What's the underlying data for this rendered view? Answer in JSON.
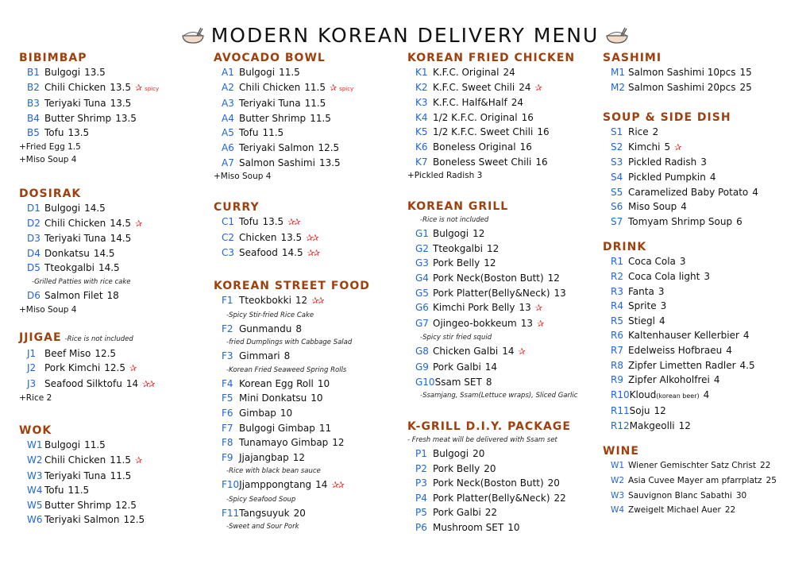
{
  "title": "MODERN KOREAN DELIVERY MENU",
  "colors": {
    "section": "#a0400c",
    "code": "#1f66d6",
    "spicy": "#e5231e"
  },
  "columns": [
    {
      "sections": [
        {
          "title": "BIBIMBAP",
          "note": "",
          "items": [
            {
              "code": "B1",
              "name": "Bulgogi",
              "price": "13.5",
              "spicy": 0
            },
            {
              "code": "B2",
              "name": "Chili Chicken",
              "price": "13.5",
              "spicy": 1,
              "spicy_label": "spicy"
            },
            {
              "code": "B3",
              "name": "Teriyaki Tuna",
              "price": "13.5",
              "spicy": 0
            },
            {
              "code": "B4",
              "name": "Butter Shrimp",
              "price": "13.5",
              "spicy": 0
            },
            {
              "code": "B5",
              "name": "Tofu",
              "price": "13.5",
              "spicy": 0
            }
          ],
          "addons": [
            "+Fried Egg 1.5",
            "+Miso Soup 4"
          ]
        },
        {
          "title": "DOSIRAK",
          "note": "",
          "items": [
            {
              "code": "D1",
              "name": "Bulgogi",
              "price": "14.5",
              "spicy": 0
            },
            {
              "code": "D2",
              "name": "Chili Chicken",
              "price": "14.5",
              "spicy": 1
            },
            {
              "code": "D3",
              "name": "Teriyaki Tuna",
              "price": "14.5",
              "spicy": 0
            },
            {
              "code": "D4",
              "name": "Donkatsu",
              "price": "14.5",
              "spicy": 0
            },
            {
              "code": "D5",
              "name": "Tteokgalbi",
              "price": "14.5",
              "spicy": 0,
              "desc": "-Grilled Patties with rice cake"
            },
            {
              "code": "D6",
              "name": "Salmon Filet",
              "price": "18",
              "spicy": 0
            }
          ],
          "addons": [
            "+Miso Soup 4"
          ]
        },
        {
          "title": "JJIGAE",
          "note": "-Rice is not included",
          "items": [
            {
              "code": "J1",
              "name": "Beef Miso",
              "price": "12.5",
              "spicy": 0
            },
            {
              "code": "J2",
              "name": "Pork Kimchi",
              "price": "12.5",
              "spicy": 1
            },
            {
              "code": "J3",
              "name": "Seafood Silktofu",
              "price": "14",
              "spicy": 2
            }
          ],
          "addons": [
            "+Rice 2"
          ]
        },
        {
          "title": "WOK",
          "note": "",
          "items": [
            {
              "code": "W1",
              "name": "Bulgogi",
              "price": "11.5",
              "spicy": 0
            },
            {
              "code": "W2",
              "name": "Chili Chicken",
              "price": "11.5",
              "spicy": 1
            },
            {
              "code": "W3",
              "name": "Teriyaki Tuna",
              "price": "11.5",
              "spicy": 0
            },
            {
              "code": "W4",
              "name": "Tofu",
              "price": "11.5",
              "spicy": 0
            },
            {
              "code": "W5",
              "name": "Butter Shrimp",
              "price": "12.5",
              "spicy": 0
            },
            {
              "code": "W6",
              "name": "Teriyaki Salmon",
              "price": "12.5",
              "spicy": 0
            }
          ],
          "addons": []
        }
      ]
    },
    {
      "sections": [
        {
          "title": "AVOCADO BOWL",
          "note": "",
          "items": [
            {
              "code": "A1",
              "name": "Bulgogi",
              "price": "11.5",
              "spicy": 0
            },
            {
              "code": "A2",
              "name": "Chili Chicken",
              "price": "11.5",
              "spicy": 1,
              "spicy_label": "spicy"
            },
            {
              "code": "A3",
              "name": "Teriyaki Tuna",
              "price": "11.5",
              "spicy": 0
            },
            {
              "code": "A4",
              "name": "Butter Shrimp",
              "price": "11.5",
              "spicy": 0
            },
            {
              "code": "A5",
              "name": "Tofu",
              "price": "11.5",
              "spicy": 0
            },
            {
              "code": "A6",
              "name": "Teriyaki Salmon",
              "price": "12.5",
              "spicy": 0
            },
            {
              "code": "A7",
              "name": "Salmon Sashimi",
              "price": "13.5",
              "spicy": 0
            }
          ],
          "addons": [
            "+Miso Soup 4"
          ]
        },
        {
          "title": "CURRY",
          "note": "",
          "items": [
            {
              "code": "C1",
              "name": "Tofu",
              "price": "13.5",
              "spicy": 2
            },
            {
              "code": "C2",
              "name": "Chicken",
              "price": "13.5",
              "spicy": 2
            },
            {
              "code": "C3",
              "name": "Seafood",
              "price": "14.5",
              "spicy": 2
            }
          ],
          "addons": []
        },
        {
          "title": "KOREAN STREET FOOD",
          "note": "",
          "items": [
            {
              "code": "F1",
              "name": "Tteokbokki",
              "price": "12",
              "spicy": 2,
              "desc": "-Spicy Stir-fried Rice Cake"
            },
            {
              "code": "F2",
              "name": "Gunmandu",
              "price": "8",
              "spicy": 0,
              "desc": "-fried Dumplings with Cabbage Salad"
            },
            {
              "code": "F3",
              "name": "Gimmari",
              "price": "8",
              "spicy": 0,
              "desc": "-Korean Fried Seaweed Spring Rolls"
            },
            {
              "code": "F4",
              "name": "Korean Egg Roll",
              "price": "10",
              "spicy": 0
            },
            {
              "code": "F5",
              "name": "Mini Donkatsu",
              "price": "10",
              "spicy": 0
            },
            {
              "code": "F6",
              "name": "Gimbap",
              "price": "10",
              "spicy": 0
            },
            {
              "code": "F7",
              "name": "Bulgogi Gimbap",
              "price": "11",
              "spicy": 0
            },
            {
              "code": "F8",
              "name": "Tunamayo Gimbap",
              "price": "12",
              "spicy": 0
            },
            {
              "code": "F9",
              "name": "Jjajangbap",
              "price": "12",
              "spicy": 0,
              "desc": "-Rice with black bean sauce"
            },
            {
              "code": "F10",
              "name": "Jjamppongtang",
              "price": "14",
              "spicy": 2,
              "desc": "-Spicy Seafood Soup"
            },
            {
              "code": "F11",
              "name": "Tangsuyuk",
              "price": "20",
              "spicy": 0,
              "desc": "-Sweet and Sour Pork"
            }
          ],
          "addons": []
        }
      ]
    },
    {
      "sections": [
        {
          "title": "KOREAN FRIED CHICKEN",
          "note": "",
          "items": [
            {
              "code": "K1",
              "name": "K.F.C. Original",
              "price": "24",
              "spicy": 0
            },
            {
              "code": "K2",
              "name": "K.F.C. Sweet Chili",
              "price": "24",
              "spicy": 1
            },
            {
              "code": "K3",
              "name": "K.F.C. Half&Half",
              "price": "24",
              "spicy": 0
            },
            {
              "code": "K4",
              "name": "1/2 K.F.C. Original",
              "price": "16",
              "spicy": 0
            },
            {
              "code": "K5",
              "name": "1/2 K.F.C. Sweet Chili",
              "price": "16",
              "spicy": 0
            },
            {
              "code": "K6",
              "name": "Boneless Original",
              "price": "16",
              "spicy": 0
            },
            {
              "code": "K7",
              "name": "Boneless Sweet Chili",
              "price": "16",
              "spicy": 0
            }
          ],
          "addons": [
            "+Pickled Radish 3"
          ]
        },
        {
          "title": "KOREAN GRILL",
          "note": "",
          "subnote": "-Rice is not included",
          "items": [
            {
              "code": "G1",
              "name": "Bulgogi",
              "price": "12",
              "spicy": 0
            },
            {
              "code": "G2",
              "name": "Tteokgalbi",
              "price": "12",
              "spicy": 0
            },
            {
              "code": "G3",
              "name": "Pork Belly",
              "price": "12",
              "spicy": 0
            },
            {
              "code": "G4",
              "name": "Pork Neck(Boston Butt)",
              "price": "12",
              "spicy": 0
            },
            {
              "code": "G5",
              "name": "Pork Platter(Belly&Neck)",
              "price": "13",
              "spicy": 0
            },
            {
              "code": "G6",
              "name": "Kimchi Pork Belly",
              "price": "13",
              "spicy": 1
            },
            {
              "code": "G7",
              "name": "Ojingeo-bokkeum",
              "price": "13",
              "spicy": 1,
              "desc": "-Spicy stir fried squid"
            },
            {
              "code": "G8",
              "name": "Chicken Galbi",
              "price": "14",
              "spicy": 1
            },
            {
              "code": "G9",
              "name": "Pork Galbi",
              "price": "14",
              "spicy": 0
            },
            {
              "code": "G10",
              "name": "Ssam SET",
              "price": "8",
              "spicy": 0,
              "desc": "-Ssamjang, Ssam(Lettuce wraps), Sliced Garlic"
            }
          ],
          "addons": []
        },
        {
          "title": "K-GRILL D.I.Y. PACKAGE",
          "note": "",
          "subnote": "- Fresh meat will be delivered with Ssam set",
          "items": [
            {
              "code": "P1",
              "name": "Bulgogi",
              "price": "20",
              "spicy": 0
            },
            {
              "code": "P2",
              "name": "Pork Belly",
              "price": "20",
              "spicy": 0
            },
            {
              "code": "P3",
              "name": "Pork Neck(Boston Butt)",
              "price": "20",
              "spicy": 0
            },
            {
              "code": "P4",
              "name": "Pork Platter(Belly&Neck)",
              "price": "22",
              "spicy": 0
            },
            {
              "code": "P5",
              "name": "Pork Galbi",
              "price": "22",
              "spicy": 0
            },
            {
              "code": "P6",
              "name": "Mushroom SET",
              "price": "10",
              "spicy": 0
            }
          ],
          "addons": []
        }
      ]
    },
    {
      "sections": [
        {
          "title": "SASHIMI",
          "note": "",
          "items": [
            {
              "code": "M1",
              "name": "Salmon Sashimi 10pcs",
              "price": "15",
              "spicy": 0
            },
            {
              "code": "M2",
              "name": "Salmon Sashimi 20pcs",
              "price": "25",
              "spicy": 0
            }
          ],
          "addons": []
        },
        {
          "title": "SOUP & SIDE DISH",
          "note": "",
          "items": [
            {
              "code": "S1",
              "name": "Rice",
              "price": "2",
              "spicy": 0
            },
            {
              "code": "S2",
              "name": "Kimchi",
              "price": "5",
              "spicy": 1
            },
            {
              "code": "S3",
              "name": "Pickled Radish",
              "price": "3",
              "spicy": 0
            },
            {
              "code": "S4",
              "name": "Pickled Pumpkin",
              "price": "4",
              "spicy": 0
            },
            {
              "code": "S5",
              "name": "Caramelized Baby Potato",
              "price": "4",
              "spicy": 0
            },
            {
              "code": "S6",
              "name": "Miso Soup",
              "price": "4",
              "spicy": 0
            },
            {
              "code": "S7",
              "name": "Tomyam Shrimp Soup",
              "price": "6",
              "spicy": 0
            }
          ],
          "addons": []
        },
        {
          "title": "DRINK",
          "note": "",
          "items": [
            {
              "code": "R1",
              "name": "Coca Cola",
              "price": "3",
              "spicy": 0
            },
            {
              "code": "R2",
              "name": "Coca Cola light",
              "price": "3",
              "spicy": 0
            },
            {
              "code": "R3",
              "name": "Fanta",
              "price": "3",
              "spicy": 0
            },
            {
              "code": "R4",
              "name": "Sprite",
              "price": "3",
              "spicy": 0
            },
            {
              "code": "R5",
              "name": "Stiegl",
              "price": "4",
              "spicy": 0
            },
            {
              "code": "R6",
              "name": "Kaltenhauser Kellerbier",
              "price": "4",
              "spicy": 0
            },
            {
              "code": "R7",
              "name": "Edelweiss Hofbraeu",
              "price": "4",
              "spicy": 0
            },
            {
              "code": "R8",
              "name": "Zipfer Limetten Radler",
              "price": "4.5",
              "spicy": 0
            },
            {
              "code": "R9",
              "name": "Zipfer Alkoholfrei",
              "price": "4",
              "spicy": 0
            },
            {
              "code": "R10",
              "name": "Kloud",
              "name_small": "(korean beer)",
              "price": "4",
              "spicy": 0
            },
            {
              "code": "R11",
              "name": "Soju",
              "price": "12",
              "spicy": 0
            },
            {
              "code": "R12",
              "name": "Makgeolli",
              "price": "12",
              "spicy": 0
            }
          ],
          "addons": []
        },
        {
          "title": "WINE",
          "note": "",
          "small": true,
          "items": [
            {
              "code": "W1",
              "name": "Wiener Gemischter Satz Christ",
              "price": "22",
              "spicy": 0
            },
            {
              "code": "W2",
              "name": "Asia Cuvee Mayer am pfarrplatz",
              "price": "25",
              "spicy": 0
            },
            {
              "code": "W3",
              "name": "Sauvignon Blanc Sabathi",
              "price": "30",
              "spicy": 0
            },
            {
              "code": "W4",
              "name": "Zweigelt Michael Auer",
              "price": "22",
              "spicy": 0
            }
          ],
          "addons": []
        }
      ]
    }
  ]
}
